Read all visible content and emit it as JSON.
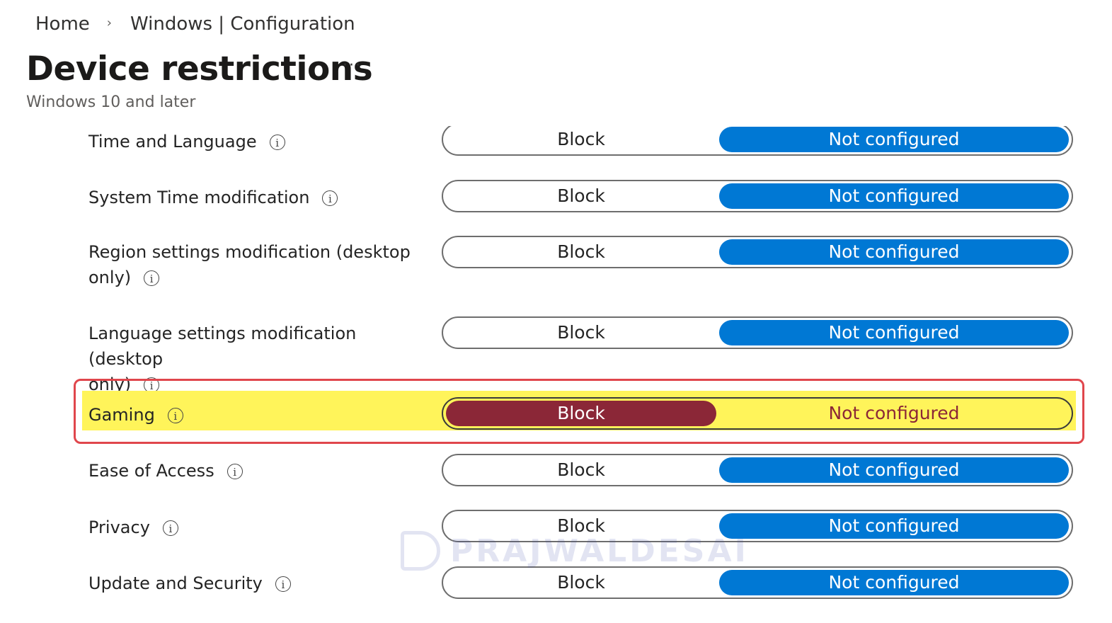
{
  "breadcrumb": {
    "home": "Home",
    "separator": "›",
    "current": "Windows | Configuration"
  },
  "header": {
    "title": "Device restrictions",
    "more": "···",
    "subtitle": "Windows 10 and later"
  },
  "info_glyph": "i",
  "rows": [
    {
      "label": "Time and Language",
      "block": "Block",
      "not_configured": "Not configured",
      "selected": "Not configured"
    },
    {
      "label": "System Time modification",
      "block": "Block",
      "not_configured": "Not configured",
      "selected": "Not configured"
    },
    {
      "label_line1": "Region settings modification (desktop",
      "label_line2": "only)",
      "block": "Block",
      "not_configured": "Not configured",
      "selected": "Not configured"
    },
    {
      "label_line1": "Language settings modification (desktop",
      "label_line2": "only)",
      "block": "Block",
      "not_configured": "Not configured",
      "selected": "Not configured"
    },
    {
      "label": "Gaming",
      "block": "Block",
      "not_configured": "Not configured",
      "selected": "Block",
      "highlighted": true
    },
    {
      "label": "Ease of Access",
      "block": "Block",
      "not_configured": "Not configured",
      "selected": "Not configured"
    },
    {
      "label": "Privacy",
      "block": "Block",
      "not_configured": "Not configured",
      "selected": "Not configured"
    },
    {
      "label": "Update and Security",
      "block": "Block",
      "not_configured": "Not configured",
      "selected": "Not configured"
    }
  ],
  "watermark": "PRAJWALDESAI",
  "colors": {
    "accent_blue": "#0078d4",
    "block_selected": "#8b2737",
    "highlight_yellow": "#fff45a",
    "highlight_border": "#e0464c"
  },
  "icons": {
    "breadcrumb_separator": "chevron-right-icon",
    "info": "info-icon",
    "more": "more-options-icon"
  }
}
